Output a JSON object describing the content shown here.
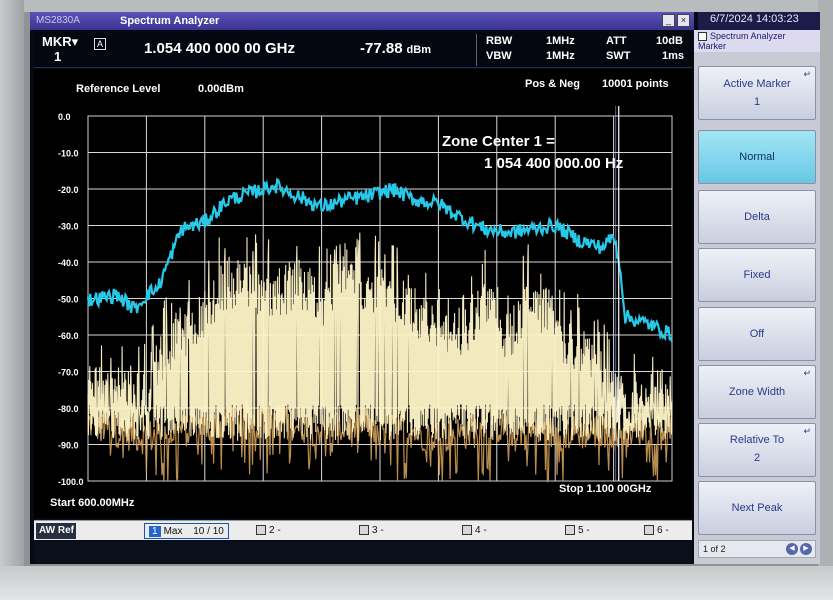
{
  "window": {
    "model": "MS2830A",
    "title": "Spectrum Analyzer",
    "datetime": "6/7/2024 14:03:23"
  },
  "header": {
    "marker_label": "MKR",
    "marker_number": "1",
    "marker_mode_badge": "A",
    "marker_frequency": "1.054 400 000 00 GHz",
    "marker_level": "-77.88",
    "marker_level_unit": "dBm",
    "rbw_label": "RBW",
    "rbw_value": "1MHz",
    "vbw_label": "VBW",
    "vbw_value": "1MHz",
    "att_label": "ATT",
    "att_value": "10dB",
    "swt_label": "SWT",
    "swt_value": "1ms"
  },
  "graph": {
    "reference_level_label": "Reference Level",
    "reference_level_value": "0.00dBm",
    "detector": "Pos & Neg",
    "points": "10001 points",
    "zone_center_label": "Zone Center 1 =",
    "zone_center_value": "1 054 400 000.00 Hz",
    "start_label": "Start 600.00MHz",
    "stop_label": "Stop 1.100 00GHz"
  },
  "chart_data": {
    "type": "line",
    "x_unit": "MHz",
    "y_unit": "dBm",
    "xlim": [
      600,
      1100
    ],
    "ylim": [
      -100,
      0
    ],
    "y_ticks": [
      "0.0",
      "-10.0",
      "-20.0",
      "-30.0",
      "-40.0",
      "-50.0",
      "-60.0",
      "-70.0",
      "-80.0",
      "-90.0",
      "-100.0"
    ],
    "grid": true,
    "marker_x": 1054.4,
    "series": [
      {
        "color": "#28c8e8",
        "x": [
          600,
          625,
          640,
          650,
          660,
          680,
          700,
          720,
          740,
          760,
          780,
          800,
          820,
          840,
          860,
          880,
          900,
          920,
          940,
          960,
          980,
          1000,
          1020,
          1040,
          1050,
          1055,
          1060,
          1080,
          1100
        ],
        "y": [
          -50.5,
          -49,
          -53,
          -49,
          -47,
          -31,
          -29,
          -23,
          -21,
          -19,
          -22,
          -25,
          -23,
          -22,
          -20,
          -23,
          -24,
          -28,
          -31,
          -32,
          -31,
          -30,
          -34,
          -36,
          -33,
          -40,
          -55,
          -57,
          -60
        ]
      },
      {
        "color": "#fff6c8",
        "x": [
          600,
          650,
          660,
          700,
          720,
          760,
          780,
          800,
          820,
          840,
          860,
          880,
          900,
          920,
          940,
          960,
          980,
          1000,
          1020,
          1040,
          1050,
          1060,
          1080,
          1100
        ],
        "y": [
          -74,
          -76,
          -66,
          -52,
          -44,
          -48,
          -44,
          -50,
          -40,
          -46,
          -48,
          -52,
          -56,
          -58,
          -50,
          -60,
          -46,
          -58,
          -62,
          -70,
          -72,
          -80,
          -76,
          -74
        ]
      },
      {
        "color": "#d9a65a",
        "x": [
          600,
          650,
          700,
          750,
          800,
          850,
          900,
          950,
          1000,
          1050,
          1100
        ],
        "y": [
          -84,
          -88,
          -85,
          -82,
          -86,
          -84,
          -88,
          -85,
          -87,
          -86,
          -85
        ]
      }
    ]
  },
  "statusbar": {
    "tag": "AW Ref",
    "trace_number": "1",
    "trace_label": "Max",
    "trace_count": "10 / 10",
    "trace2": "2 -",
    "trace3": "3 -",
    "trace4": "4 -",
    "trace5": "5 -",
    "trace6": "6 -"
  },
  "softpanel": {
    "title": "Spectrum Analyzer",
    "subtitle": "Marker",
    "keys": [
      {
        "label": "Active Marker",
        "sub": "1"
      },
      {
        "label": "Normal",
        "sub": ""
      },
      {
        "label": "Delta",
        "sub": ""
      },
      {
        "label": "Fixed",
        "sub": ""
      },
      {
        "label": "Off",
        "sub": ""
      },
      {
        "label": "Zone Width",
        "sub": ""
      },
      {
        "label": "Relative To",
        "sub": "2"
      },
      {
        "label": "Next Peak",
        "sub": ""
      }
    ],
    "page": "1 of 2"
  }
}
